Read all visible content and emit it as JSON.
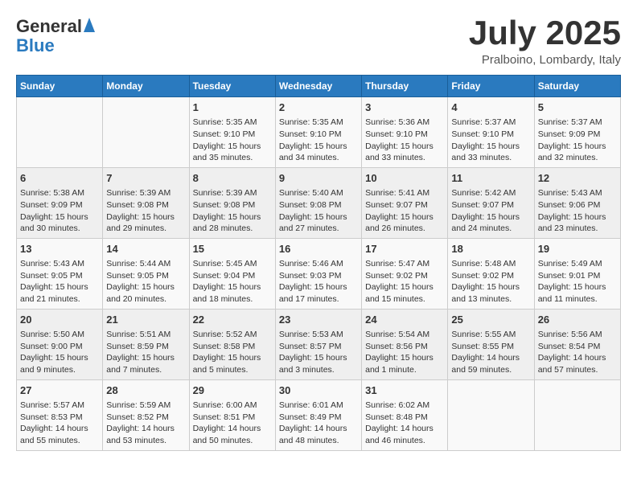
{
  "header": {
    "logo_line1": "General",
    "logo_line2": "Blue",
    "month": "July 2025",
    "location": "Pralboino, Lombardy, Italy"
  },
  "weekdays": [
    "Sunday",
    "Monday",
    "Tuesday",
    "Wednesday",
    "Thursday",
    "Friday",
    "Saturday"
  ],
  "weeks": [
    [
      {
        "day": "",
        "info": ""
      },
      {
        "day": "",
        "info": ""
      },
      {
        "day": "1",
        "info": "Sunrise: 5:35 AM\nSunset: 9:10 PM\nDaylight: 15 hours and 35 minutes."
      },
      {
        "day": "2",
        "info": "Sunrise: 5:35 AM\nSunset: 9:10 PM\nDaylight: 15 hours and 34 minutes."
      },
      {
        "day": "3",
        "info": "Sunrise: 5:36 AM\nSunset: 9:10 PM\nDaylight: 15 hours and 33 minutes."
      },
      {
        "day": "4",
        "info": "Sunrise: 5:37 AM\nSunset: 9:10 PM\nDaylight: 15 hours and 33 minutes."
      },
      {
        "day": "5",
        "info": "Sunrise: 5:37 AM\nSunset: 9:09 PM\nDaylight: 15 hours and 32 minutes."
      }
    ],
    [
      {
        "day": "6",
        "info": "Sunrise: 5:38 AM\nSunset: 9:09 PM\nDaylight: 15 hours and 30 minutes."
      },
      {
        "day": "7",
        "info": "Sunrise: 5:39 AM\nSunset: 9:08 PM\nDaylight: 15 hours and 29 minutes."
      },
      {
        "day": "8",
        "info": "Sunrise: 5:39 AM\nSunset: 9:08 PM\nDaylight: 15 hours and 28 minutes."
      },
      {
        "day": "9",
        "info": "Sunrise: 5:40 AM\nSunset: 9:08 PM\nDaylight: 15 hours and 27 minutes."
      },
      {
        "day": "10",
        "info": "Sunrise: 5:41 AM\nSunset: 9:07 PM\nDaylight: 15 hours and 26 minutes."
      },
      {
        "day": "11",
        "info": "Sunrise: 5:42 AM\nSunset: 9:07 PM\nDaylight: 15 hours and 24 minutes."
      },
      {
        "day": "12",
        "info": "Sunrise: 5:43 AM\nSunset: 9:06 PM\nDaylight: 15 hours and 23 minutes."
      }
    ],
    [
      {
        "day": "13",
        "info": "Sunrise: 5:43 AM\nSunset: 9:05 PM\nDaylight: 15 hours and 21 minutes."
      },
      {
        "day": "14",
        "info": "Sunrise: 5:44 AM\nSunset: 9:05 PM\nDaylight: 15 hours and 20 minutes."
      },
      {
        "day": "15",
        "info": "Sunrise: 5:45 AM\nSunset: 9:04 PM\nDaylight: 15 hours and 18 minutes."
      },
      {
        "day": "16",
        "info": "Sunrise: 5:46 AM\nSunset: 9:03 PM\nDaylight: 15 hours and 17 minutes."
      },
      {
        "day": "17",
        "info": "Sunrise: 5:47 AM\nSunset: 9:02 PM\nDaylight: 15 hours and 15 minutes."
      },
      {
        "day": "18",
        "info": "Sunrise: 5:48 AM\nSunset: 9:02 PM\nDaylight: 15 hours and 13 minutes."
      },
      {
        "day": "19",
        "info": "Sunrise: 5:49 AM\nSunset: 9:01 PM\nDaylight: 15 hours and 11 minutes."
      }
    ],
    [
      {
        "day": "20",
        "info": "Sunrise: 5:50 AM\nSunset: 9:00 PM\nDaylight: 15 hours and 9 minutes."
      },
      {
        "day": "21",
        "info": "Sunrise: 5:51 AM\nSunset: 8:59 PM\nDaylight: 15 hours and 7 minutes."
      },
      {
        "day": "22",
        "info": "Sunrise: 5:52 AM\nSunset: 8:58 PM\nDaylight: 15 hours and 5 minutes."
      },
      {
        "day": "23",
        "info": "Sunrise: 5:53 AM\nSunset: 8:57 PM\nDaylight: 15 hours and 3 minutes."
      },
      {
        "day": "24",
        "info": "Sunrise: 5:54 AM\nSunset: 8:56 PM\nDaylight: 15 hours and 1 minute."
      },
      {
        "day": "25",
        "info": "Sunrise: 5:55 AM\nSunset: 8:55 PM\nDaylight: 14 hours and 59 minutes."
      },
      {
        "day": "26",
        "info": "Sunrise: 5:56 AM\nSunset: 8:54 PM\nDaylight: 14 hours and 57 minutes."
      }
    ],
    [
      {
        "day": "27",
        "info": "Sunrise: 5:57 AM\nSunset: 8:53 PM\nDaylight: 14 hours and 55 minutes."
      },
      {
        "day": "28",
        "info": "Sunrise: 5:59 AM\nSunset: 8:52 PM\nDaylight: 14 hours and 53 minutes."
      },
      {
        "day": "29",
        "info": "Sunrise: 6:00 AM\nSunset: 8:51 PM\nDaylight: 14 hours and 50 minutes."
      },
      {
        "day": "30",
        "info": "Sunrise: 6:01 AM\nSunset: 8:49 PM\nDaylight: 14 hours and 48 minutes."
      },
      {
        "day": "31",
        "info": "Sunrise: 6:02 AM\nSunset: 8:48 PM\nDaylight: 14 hours and 46 minutes."
      },
      {
        "day": "",
        "info": ""
      },
      {
        "day": "",
        "info": ""
      }
    ]
  ]
}
